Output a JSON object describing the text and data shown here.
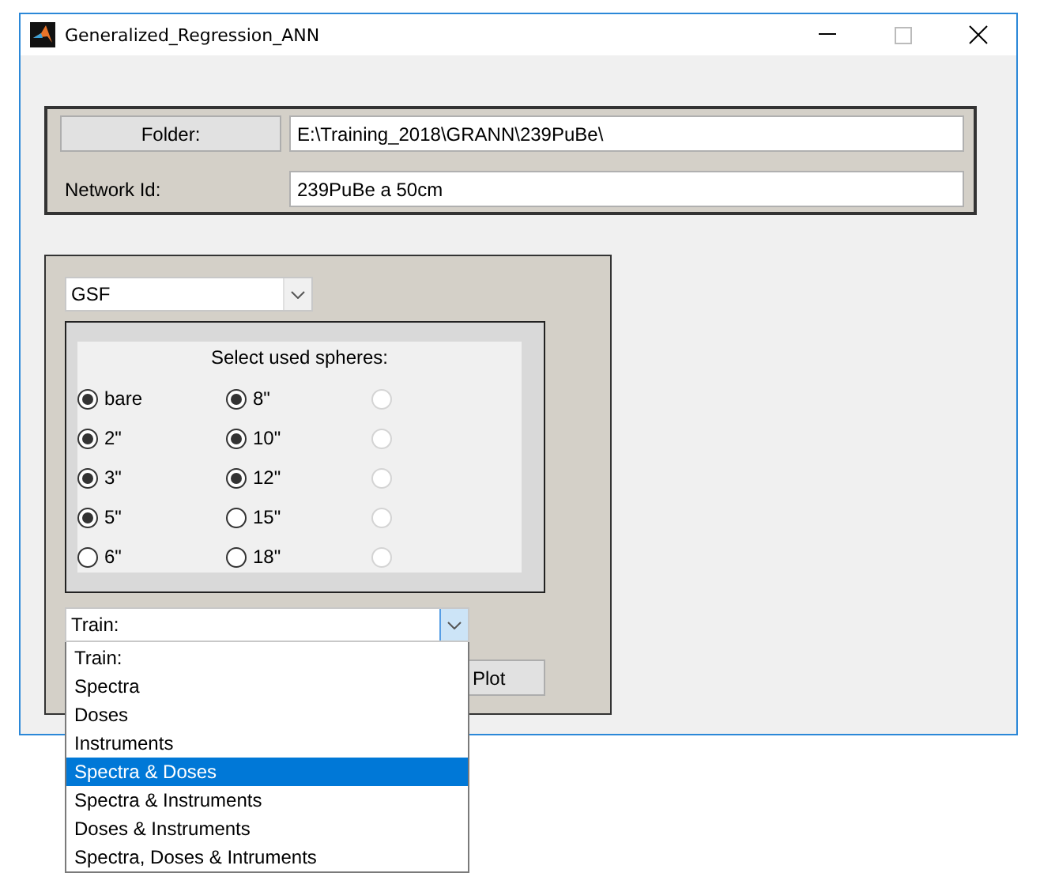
{
  "window": {
    "title": "Generalized_Regression_ANN"
  },
  "folder": {
    "button": "Folder:",
    "value": "E:\\Training_2018\\GRANN\\239PuBe\\"
  },
  "network": {
    "label": "Network Id:",
    "value": "239PuBe a 50cm"
  },
  "type_select": {
    "value": "GSF"
  },
  "spheres": {
    "title": "Select used spheres:",
    "columns": [
      {
        "items": [
          {
            "label": "bare",
            "checked": true,
            "disabled": false
          },
          {
            "label": "2\"",
            "checked": true,
            "disabled": false
          },
          {
            "label": "3\"",
            "checked": true,
            "disabled": false
          },
          {
            "label": "5\"",
            "checked": true,
            "disabled": false
          },
          {
            "label": "6\"",
            "checked": false,
            "disabled": false
          }
        ]
      },
      {
        "items": [
          {
            "label": "8\"",
            "checked": true,
            "disabled": false
          },
          {
            "label": "10\"",
            "checked": true,
            "disabled": false
          },
          {
            "label": "12\"",
            "checked": true,
            "disabled": false
          },
          {
            "label": "15\"",
            "checked": false,
            "disabled": false
          },
          {
            "label": "18\"",
            "checked": false,
            "disabled": false
          }
        ]
      },
      {
        "items": [
          {
            "checked": false,
            "disabled": true
          },
          {
            "checked": false,
            "disabled": true
          },
          {
            "checked": false,
            "disabled": true
          },
          {
            "checked": false,
            "disabled": true
          },
          {
            "checked": false,
            "disabled": true
          }
        ]
      }
    ]
  },
  "train_select": {
    "value": "Train:",
    "expanded": true,
    "options": [
      {
        "label": "Train:",
        "highlighted": false
      },
      {
        "label": "Spectra",
        "highlighted": false
      },
      {
        "label": "Doses",
        "highlighted": false
      },
      {
        "label": "Instruments",
        "highlighted": false
      },
      {
        "label": "Spectra & Doses",
        "highlighted": true
      },
      {
        "label": "Spectra & Instruments",
        "highlighted": false
      },
      {
        "label": "Doses & Instruments",
        "highlighted": false
      },
      {
        "label": "Spectra, Doses & Intruments",
        "highlighted": false
      }
    ]
  },
  "plot_button": {
    "label": "Plot"
  }
}
